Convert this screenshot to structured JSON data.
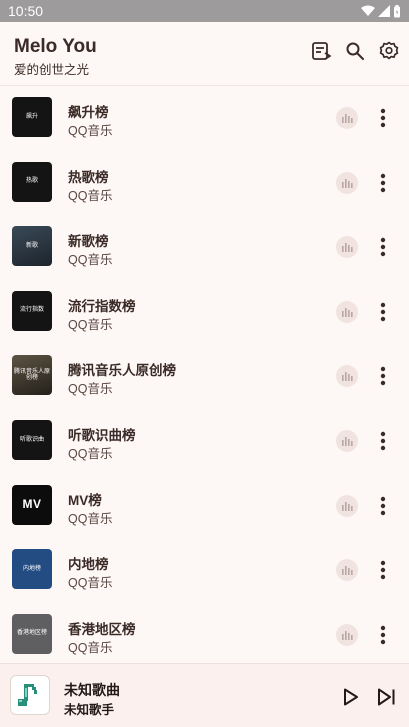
{
  "status": {
    "time": "10:50"
  },
  "app": {
    "title": "Melo You",
    "subtitle": "爱的创世之光"
  },
  "icons": {
    "playlist": "playlist-icon",
    "search": "search-icon",
    "settings": "gear-icon"
  },
  "charts": [
    {
      "title": "飙升榜",
      "source": "QQ音乐",
      "cover_text": "飙升",
      "cover_style": "c-dark"
    },
    {
      "title": "热歌榜",
      "source": "QQ音乐",
      "cover_text": "热歌",
      "cover_style": "c-dark"
    },
    {
      "title": "新歌榜",
      "source": "QQ音乐",
      "cover_text": "新歌",
      "cover_style": "c-grad"
    },
    {
      "title": "流行指数榜",
      "source": "QQ音乐",
      "cover_text": "流行指数",
      "cover_style": "c-dark"
    },
    {
      "title": "腾讯音乐人原创榜",
      "source": "QQ音乐",
      "cover_text": "腾讯音乐人原创榜",
      "cover_style": "c-sepia"
    },
    {
      "title": "听歌识曲榜",
      "source": "QQ音乐",
      "cover_text": "听歌识曲",
      "cover_style": "c-dark"
    },
    {
      "title": "MV榜",
      "source": "QQ音乐",
      "cover_text": "MV",
      "cover_style": "c-mv"
    },
    {
      "title": "内地榜",
      "source": "QQ音乐",
      "cover_text": "内地榜",
      "cover_style": "c-blue"
    },
    {
      "title": "香港地区榜",
      "source": "QQ音乐",
      "cover_text": "香港地区榜",
      "cover_style": "c-grey"
    }
  ],
  "player": {
    "song_title": "未知歌曲",
    "artist": "未知歌手"
  },
  "colors": {
    "background": "#fdf7f5",
    "statusbar": "#9d9b9b",
    "text": "#3b2b27",
    "accent_art": "#2a8f7a"
  }
}
